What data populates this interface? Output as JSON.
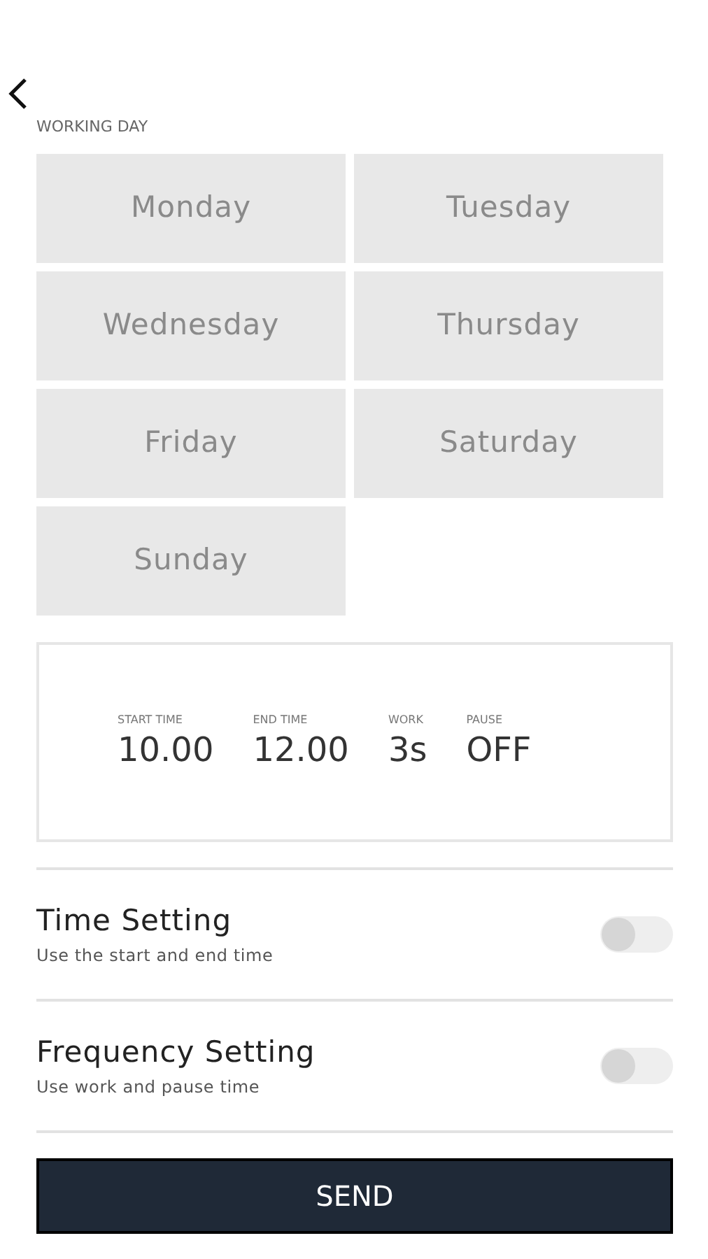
{
  "section_label": "WORKING DAY",
  "days": [
    {
      "label": "Monday",
      "selected": false
    },
    {
      "label": "Tuesday",
      "selected": false
    },
    {
      "label": "Wednesday",
      "selected": false
    },
    {
      "label": "Thursday",
      "selected": false
    },
    {
      "label": "Friday",
      "selected": false
    },
    {
      "label": "Saturday",
      "selected": false
    },
    {
      "label": "Sunday",
      "selected": false
    }
  ],
  "summary": [
    {
      "label": "START TIME",
      "value": "10.00"
    },
    {
      "label": "END TIME",
      "value": "12.00"
    },
    {
      "label": "WORK",
      "value": "3s"
    },
    {
      "label": "PAUSE",
      "value": "OFF"
    }
  ],
  "settings": [
    {
      "title": "Time Setting",
      "subtitle": "Use the start and end time",
      "on": false
    },
    {
      "title": "Frequency Setting",
      "subtitle": "Use work and pause time",
      "on": false
    }
  ],
  "send_button": "SEND"
}
